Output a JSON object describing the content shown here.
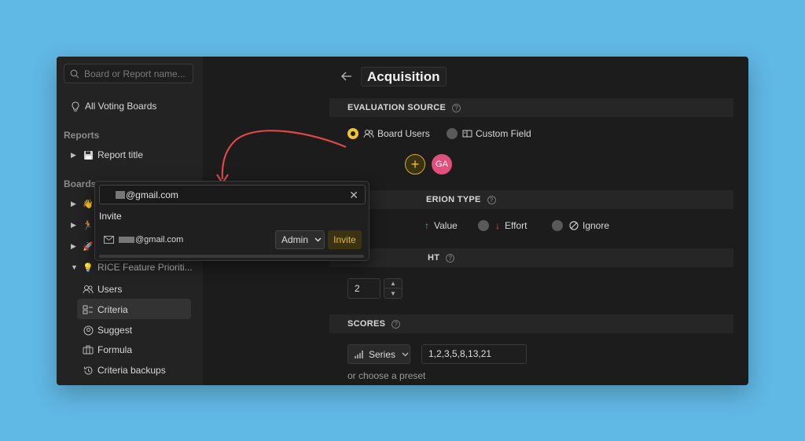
{
  "sidebar": {
    "search_placeholder": "Board or Report name...",
    "top_item": "All Voting Boards",
    "reports_heading": "Reports",
    "report_title": "Report title",
    "boards_heading": "Boards",
    "board_name": "RICE Feature Prioriti...",
    "board_icon": "💡",
    "subitems": [
      "Users",
      "Criteria",
      "Suggest",
      "Formula",
      "Criteria backups"
    ]
  },
  "page": {
    "title": "Acquisition",
    "evaluation_source_label": "EVALUATION SOURCE",
    "source_options": [
      "Board Users",
      "Custom Field"
    ],
    "member_initials": "GA",
    "criterion_type_label": "ERION TYPE",
    "criterion_options": [
      "Value",
      "Effort",
      "Ignore"
    ],
    "weight_label": "HT",
    "weight_value": "2",
    "scores_label": "SCORES",
    "series_label": "Series",
    "series_values": "1,2,3,5,8,13,21",
    "preset_hint": "or choose a preset"
  },
  "popup": {
    "email_value": "@gmail.com",
    "invite_heading": "Invite",
    "invite_email": "@gmail.com",
    "role": "Admin",
    "invite_button": "Invite"
  },
  "colors": {
    "accent": "#f0c330",
    "avatar": "#e0507a",
    "annotation_arrow": "#e04848"
  }
}
